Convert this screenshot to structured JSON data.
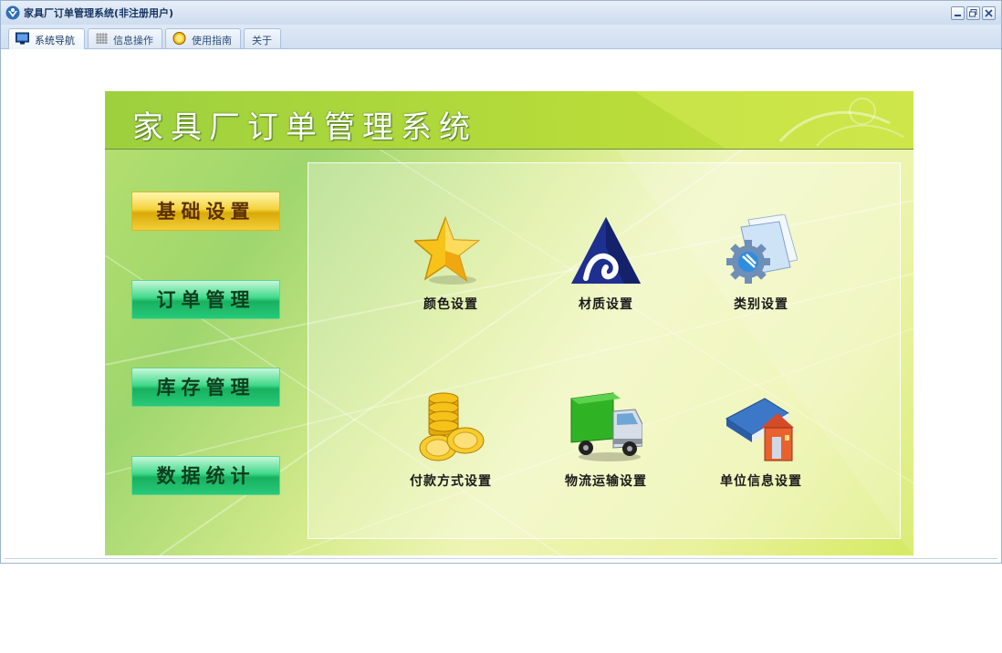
{
  "window": {
    "title": "家具厂订单管理系统(非注册用户)"
  },
  "tabs": [
    {
      "label": "系统导航",
      "icon": "monitor-icon",
      "active": true
    },
    {
      "label": "信息操作",
      "icon": "grid-icon",
      "active": false
    },
    {
      "label": "使用指南",
      "icon": "help-icon",
      "active": false
    },
    {
      "label": "关于",
      "icon": "",
      "active": false
    }
  ],
  "panel": {
    "title": "家具厂订单管理系统",
    "nav": [
      {
        "label": "基础设置",
        "style": "gold"
      },
      {
        "label": "订单管理",
        "style": "green"
      },
      {
        "label": "库存管理",
        "style": "green"
      },
      {
        "label": "数据统计",
        "style": "green"
      }
    ],
    "items": [
      {
        "label": "颜色设置",
        "icon": "star-icon"
      },
      {
        "label": "材质设置",
        "icon": "triangle-logo-icon"
      },
      {
        "label": "类别设置",
        "icon": "gear-folder-icon"
      },
      {
        "label": "付款方式设置",
        "icon": "gold-coins-icon"
      },
      {
        "label": "物流运输设置",
        "icon": "truck-icon"
      },
      {
        "label": "单位信息设置",
        "icon": "building-book-icon"
      }
    ]
  },
  "colors": {
    "titlebar": "#cddcef",
    "header_green": "#9dd03e",
    "nav_gold": "#f3d23c",
    "nav_green": "#17b15f"
  }
}
